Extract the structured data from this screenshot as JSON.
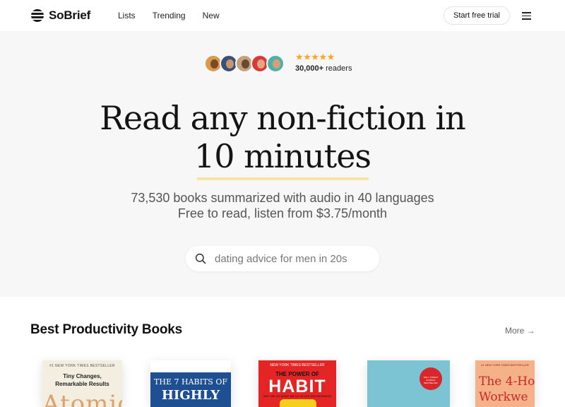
{
  "header": {
    "brand": "SoBrief",
    "nav": [
      "Lists",
      "Trending",
      "New"
    ],
    "cta_label": "Start free trial"
  },
  "hero": {
    "rating_stars": "★★★★★",
    "readers_count": "30,000+",
    "readers_label": "readers",
    "headline_line1": "Read any non-fiction in",
    "headline_line2": "10 minutes",
    "subtitle_line1": "73,530 books summarized with audio in 40 languages",
    "subtitle_line2": "Free to read, listen from $3.75/month",
    "search_placeholder": "dating advice for men in 20s"
  },
  "section": {
    "title": "Best Productivity Books",
    "more_label": "More →"
  },
  "books": {
    "atomic": {
      "tag": "#1 NEW YORK TIMES BESTSELLER",
      "subtitle_1": "Tiny Changes,",
      "subtitle_2": "Remarkable Results",
      "title": "Atomic"
    },
    "seven_habits": {
      "line1": "THE 7 HABITS OF",
      "line2": "HIGHLY"
    },
    "power_of_habit": {
      "tag": "NEW YORK TIMES BESTSELLER",
      "line1": "THE POWER OF",
      "line2": "HABIT",
      "line3": "WHY WE DO WHAT WE DO IN LIFE AND BUSINESS"
    },
    "deep_work": {
      "badge": "WALL STREET JOURNAL BESTSELLER"
    },
    "four_hour": {
      "tag": "#1 NEW YORK TIMES BESTSELLER",
      "line1": "The 4-Ho",
      "line2": "Workwe"
    }
  },
  "colors": {
    "accent_underline": "#f7e3a5",
    "star": "#f6a823",
    "hero_bg": "#f7f7f7"
  }
}
